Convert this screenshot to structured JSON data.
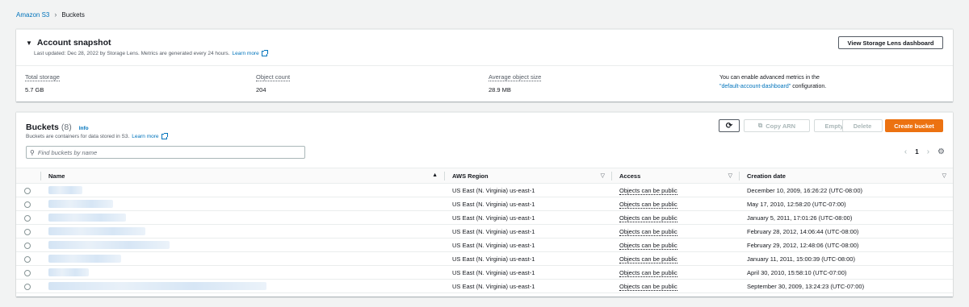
{
  "breadcrumb": {
    "root": "Amazon S3",
    "current": "Buckets"
  },
  "snapshot": {
    "title": "Account snapshot",
    "updated": "Last updated: Dec 28, 2022 by Storage Lens. Metrics are generated every 24 hours.",
    "learn_more": "Learn more",
    "view_button": "View Storage Lens dashboard",
    "metrics": [
      {
        "label": "Total storage",
        "value": "5.7 GB"
      },
      {
        "label": "Object count",
        "value": "204"
      },
      {
        "label": "Average object size",
        "value": "28.9 MB"
      }
    ],
    "advanced_text_1": "You can enable advanced metrics in the",
    "advanced_link": "\"default-account-dashboard\"",
    "advanced_text_2": " configuration."
  },
  "buckets": {
    "title": "Buckets",
    "count": "(8)",
    "info": "Info",
    "description": "Buckets are containers for data stored in S3.",
    "learn_more": "Learn more",
    "buttons": {
      "copy_arn": "Copy ARN",
      "empty": "Empty",
      "delete": "Delete",
      "create": "Create bucket"
    },
    "search_placeholder": "Find buckets by name",
    "page": "1",
    "columns": [
      "Name",
      "AWS Region",
      "Access",
      "Creation date"
    ],
    "rows": [
      {
        "region": "US East (N. Virginia) us-east-1",
        "access": "Objects can be public",
        "created": "December 10, 2009, 16:26:22 (UTC-08:00)"
      },
      {
        "region": "US East (N. Virginia) us-east-1",
        "access": "Objects can be public",
        "created": "May 17, 2010, 12:58:20 (UTC-07:00)"
      },
      {
        "region": "US East (N. Virginia) us-east-1",
        "access": "Objects can be public",
        "created": "January 5, 2011, 17:01:26 (UTC-08:00)"
      },
      {
        "region": "US East (N. Virginia) us-east-1",
        "access": "Objects can be public",
        "created": "February 28, 2012, 14:06:44 (UTC-08:00)"
      },
      {
        "region": "US East (N. Virginia) us-east-1",
        "access": "Objects can be public",
        "created": "February 29, 2012, 12:48:06 (UTC-08:00)"
      },
      {
        "region": "US East (N. Virginia) us-east-1",
        "access": "Objects can be public",
        "created": "January 11, 2011, 15:00:39 (UTC-08:00)"
      },
      {
        "region": "US East (N. Virginia) us-east-1",
        "access": "Objects can be public",
        "created": "April 30, 2010, 15:58:10 (UTC-07:00)"
      },
      {
        "region": "US East (N. Virginia) us-east-1",
        "access": "Objects can be public",
        "created": "September 30, 2009, 13:24:23 (UTC-07:00)"
      }
    ]
  },
  "colors": {
    "link": "#0073bb",
    "primary": "#ec7211",
    "background": "#f2f3f3"
  }
}
